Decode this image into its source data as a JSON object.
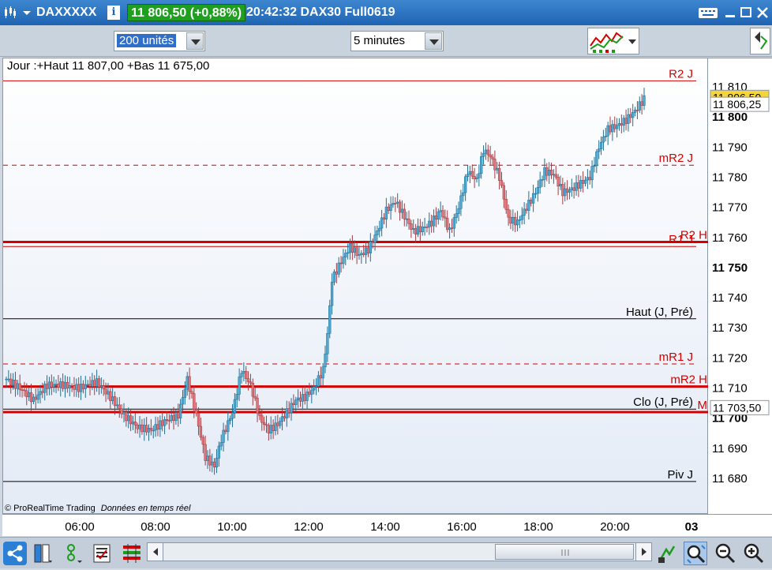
{
  "titlebar": {
    "symbol": "DAXXXXX",
    "info": "i",
    "price": "11 806,50 (+0,88%)",
    "time_label": "20:42:32 DAX30 Full0619"
  },
  "toolbar": {
    "units_value": "200 unités",
    "interval_value": "5 minutes"
  },
  "chart_info": "Jour :+Haut 11 807,00 +Bas 11 675,00",
  "watermark": {
    "brand": "© ProRealTime Trading",
    "data": "Données en temps réel"
  },
  "y_ticks": [
    {
      "v": 11810,
      "label": "11 810",
      "bold": false
    },
    {
      "v": 11800,
      "label": "11 800",
      "bold": true
    },
    {
      "v": 11790,
      "label": "11 790",
      "bold": false
    },
    {
      "v": 11780,
      "label": "11 780",
      "bold": false
    },
    {
      "v": 11770,
      "label": "11 770",
      "bold": false
    },
    {
      "v": 11760,
      "label": "11 760",
      "bold": false
    },
    {
      "v": 11750,
      "label": "11 750",
      "bold": true
    },
    {
      "v": 11740,
      "label": "11 740",
      "bold": false
    },
    {
      "v": 11730,
      "label": "11 730",
      "bold": false
    },
    {
      "v": 11720,
      "label": "11 720",
      "bold": false
    },
    {
      "v": 11710,
      "label": "11 710",
      "bold": false
    },
    {
      "v": 11700,
      "label": "11 700",
      "bold": true
    },
    {
      "v": 11690,
      "label": "11 690",
      "bold": false
    },
    {
      "v": 11680,
      "label": "11 680",
      "bold": false
    }
  ],
  "x_ticks": [
    {
      "label": "06:00"
    },
    {
      "label": "08:00"
    },
    {
      "label": "10:00"
    },
    {
      "label": "12:00"
    },
    {
      "label": "14:00"
    },
    {
      "label": "16:00"
    },
    {
      "label": "18:00"
    },
    {
      "label": "20:00"
    },
    {
      "label": "03"
    }
  ],
  "price_tags": [
    {
      "label": "11 806,50",
      "v": 11806.5,
      "bg": "#f5d53a"
    },
    {
      "label": "11 806,25",
      "v": 11804.2,
      "bg": "#ffffff"
    },
    {
      "label": "11 703,50",
      "v": 11703.5,
      "bg": "#ffffff"
    }
  ],
  "levels": [
    {
      "label": "R2 J",
      "v": 11812,
      "color": "#d40000",
      "style": "solid",
      "width": 1,
      "end": 878
    },
    {
      "label": "mR2 J",
      "v": 11784,
      "color": "#d40000",
      "style": "dashed",
      "width": 1,
      "end": 878
    },
    {
      "label": "R2 H",
      "v": 11758.5,
      "color": "#d40000",
      "style": "solid",
      "width": 3,
      "end": 897
    },
    {
      "label": "R1 J",
      "v": 11757,
      "color": "#d40000",
      "style": "solid",
      "width": 1,
      "end": 878
    },
    {
      "label": "Haut (J, Pré)",
      "v": 11733,
      "color": "#000000",
      "style": "solid",
      "width": 1,
      "end": 878
    },
    {
      "label": "mR1 J",
      "v": 11718,
      "color": "#d40000",
      "style": "dashed",
      "width": 1,
      "end": 878
    },
    {
      "label": "mR2 H",
      "v": 11710.5,
      "color": "#d40000",
      "style": "solid",
      "width": 3,
      "end": 897
    },
    {
      "label": "Clo (J, Pré)",
      "v": 11703,
      "color": "#000000",
      "style": "solid",
      "width": 1,
      "end": 878
    },
    {
      "label": "M",
      "v": 11702,
      "color": "#d40000",
      "style": "solid",
      "width": 3,
      "end": 897
    },
    {
      "label": "Piv J",
      "v": 11679,
      "color": "#000000",
      "style": "solid",
      "width": 1,
      "end": 878
    }
  ],
  "chart_data": {
    "type": "candlestick",
    "ylim": [
      11672,
      11818
    ],
    "x_ticks": [
      "06:00",
      "08:00",
      "10:00",
      "12:00",
      "14:00",
      "16:00",
      "18:00",
      "20:00",
      "03"
    ],
    "anchors": [
      [
        0,
        11713
      ],
      [
        6,
        11710
      ],
      [
        12,
        11706
      ],
      [
        18,
        11711
      ],
      [
        25,
        11711
      ],
      [
        32,
        11710
      ],
      [
        40,
        11712
      ],
      [
        46,
        11707
      ],
      [
        52,
        11701
      ],
      [
        58,
        11697
      ],
      [
        64,
        11696
      ],
      [
        70,
        11699
      ],
      [
        76,
        11701
      ],
      [
        80,
        11713
      ],
      [
        84,
        11701
      ],
      [
        88,
        11687
      ],
      [
        92,
        11684
      ],
      [
        95,
        11693
      ],
      [
        100,
        11702
      ],
      [
        104,
        11716
      ],
      [
        108,
        11711
      ],
      [
        112,
        11700
      ],
      [
        116,
        11696
      ],
      [
        120,
        11698
      ],
      [
        124,
        11702
      ],
      [
        128,
        11706
      ],
      [
        132,
        11707
      ],
      [
        136,
        11710
      ],
      [
        140,
        11716
      ],
      [
        142,
        11728
      ],
      [
        144,
        11746
      ],
      [
        148,
        11752
      ],
      [
        152,
        11757
      ],
      [
        156,
        11754
      ],
      [
        160,
        11756
      ],
      [
        164,
        11762
      ],
      [
        168,
        11769
      ],
      [
        172,
        11772
      ],
      [
        176,
        11767
      ],
      [
        180,
        11762
      ],
      [
        184,
        11763
      ],
      [
        188,
        11765
      ],
      [
        192,
        11769
      ],
      [
        196,
        11762
      ],
      [
        200,
        11770
      ],
      [
        204,
        11782
      ],
      [
        208,
        11779
      ],
      [
        211,
        11789
      ],
      [
        214,
        11787
      ],
      [
        218,
        11780
      ],
      [
        222,
        11766
      ],
      [
        226,
        11765
      ],
      [
        230,
        11770
      ],
      [
        234,
        11775
      ],
      [
        238,
        11782
      ],
      [
        242,
        11781
      ],
      [
        246,
        11775
      ],
      [
        250,
        11776
      ],
      [
        254,
        11778
      ],
      [
        258,
        11780
      ],
      [
        262,
        11790
      ],
      [
        266,
        11796
      ],
      [
        270,
        11797
      ],
      [
        274,
        11799
      ],
      [
        278,
        11802
      ],
      [
        282,
        11806
      ]
    ]
  }
}
